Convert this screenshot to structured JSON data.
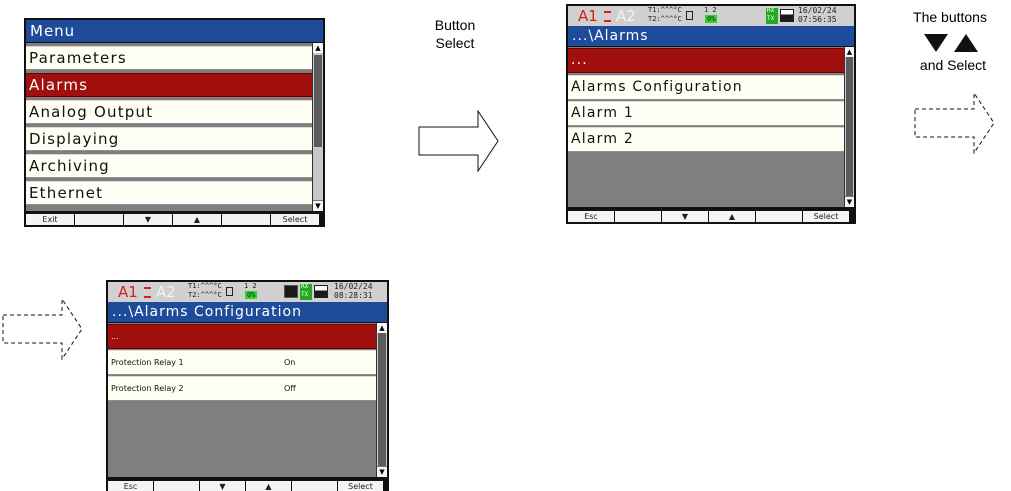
{
  "panel1": {
    "title": "Menu",
    "items": [
      "Parameters",
      "Alarms",
      "Analog Output",
      "Displaying",
      "Archiving",
      "Ethernet"
    ],
    "softkeys": [
      "Exit",
      "",
      "▼",
      "▲",
      "",
      "Select"
    ]
  },
  "caption_button": [
    "Button",
    "Select"
  ],
  "panel2": {
    "status": {
      "a1": "A1",
      "a2": "A2",
      "t1": "T1:^^^°C",
      "t2": "T2:^^^°C",
      "ch": "1 2",
      "pct": "0%",
      "rx": "RX",
      "tx": "TX",
      "date": "16/02/24",
      "time": "07:56:35"
    },
    "title": "...\\Alarms",
    "items": [
      "...",
      "Alarms Configuration",
      "Alarm 1",
      "Alarm 2"
    ],
    "softkeys": [
      "Esc",
      "",
      "▼",
      "▲",
      "",
      "Select"
    ]
  },
  "caption_buttons": {
    "line1": "The buttons",
    "line3": "and Select"
  },
  "panel3": {
    "status": {
      "a1": "A1",
      "a2": "A2",
      "t1": "T1:^^^°C",
      "t2": "T2:^^^°C",
      "ch": "1 2",
      "pct": "0%",
      "rx": "RX",
      "tx": "TX",
      "date": "16/02/24",
      "time": "08:28:31"
    },
    "title": "...\\Alarms Configuration",
    "rows": [
      {
        "label": "...",
        "value": ""
      },
      {
        "label": "Protection Relay 1",
        "value": "On"
      },
      {
        "label": "Protection Relay 2",
        "value": "Off"
      }
    ],
    "softkeys": [
      "Esc",
      "",
      "▼",
      "▲",
      "",
      "Select"
    ]
  }
}
